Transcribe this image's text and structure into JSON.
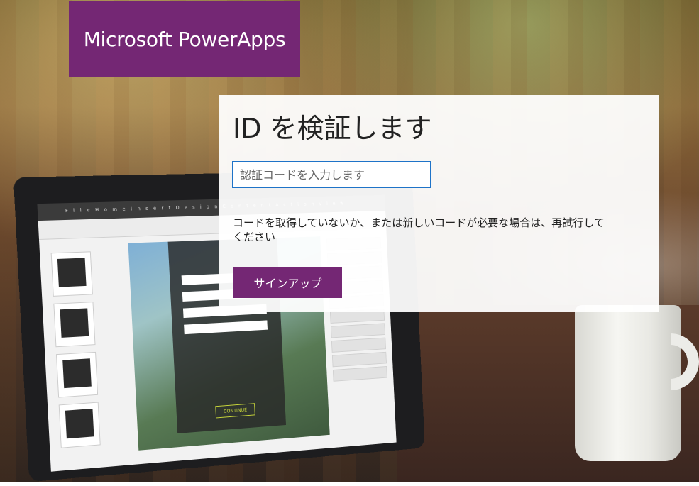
{
  "brand": {
    "title": "Microsoft PowerApps",
    "color": "#742774"
  },
  "dialog": {
    "title": "ID を検証します",
    "code_input": {
      "placeholder": "認証コードを入力します",
      "value": ""
    },
    "help_text_prefix": "コードを取得していないか、または新しいコードが必要な場合は、",
    "retry_link": "再試行して",
    "help_text_suffix": "ください",
    "signup_button": "サインアップ"
  },
  "background": {
    "laptop_app": {
      "ribbon_tabs": [
        "File",
        "Home",
        "Insert",
        "Design",
        "Content",
        "Action",
        "View"
      ],
      "form_button": "CONTINUE"
    }
  },
  "colors": {
    "accent": "#742774",
    "input_border": "#1e73c8"
  }
}
